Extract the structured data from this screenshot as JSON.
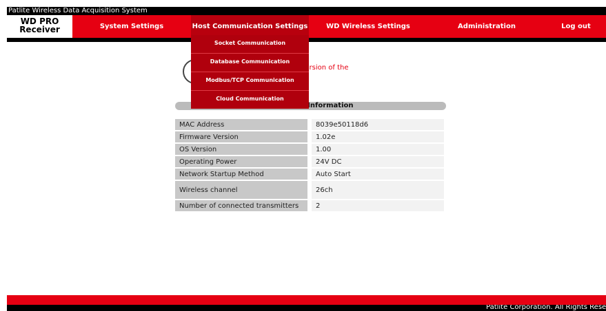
{
  "window_title": "Patlite Wireless Data Acquisition System",
  "logo": {
    "line1": "WD PRO",
    "line2": "Receiver"
  },
  "nav": {
    "system_settings": "System Settings",
    "host_comm": "Host Communication Settings",
    "wd_wireless": "WD Wireless Settings",
    "administration": "Administration",
    "logout": "Log out"
  },
  "dropdown": {
    "items": [
      "Socket Communication",
      "Database Communication",
      "Modbus/TCP Communication",
      "Cloud Communication"
    ]
  },
  "notice": {
    "visible_text": "pdating to the latest version of the"
  },
  "info": {
    "title": "Main Unit Information",
    "rows": [
      {
        "label": "MAC Address",
        "value": "8039e50118d6"
      },
      {
        "label": "Firmware Version",
        "value": "1.02e"
      },
      {
        "label": "OS Version",
        "value": "1.00"
      },
      {
        "label": "Operating Power",
        "value": "24V DC"
      },
      {
        "label": "Network Startup Method",
        "value": "Auto Start"
      },
      {
        "label": "Wireless channel",
        "value": "26ch"
      },
      {
        "label": "Number of connected transmitters",
        "value": "2"
      }
    ]
  },
  "footer": {
    "copyright": "Patlite Corporation. All Rights Reserve"
  },
  "colors": {
    "brand_red": "#e60012",
    "dark_red": "#b0000d",
    "black": "#000000"
  }
}
